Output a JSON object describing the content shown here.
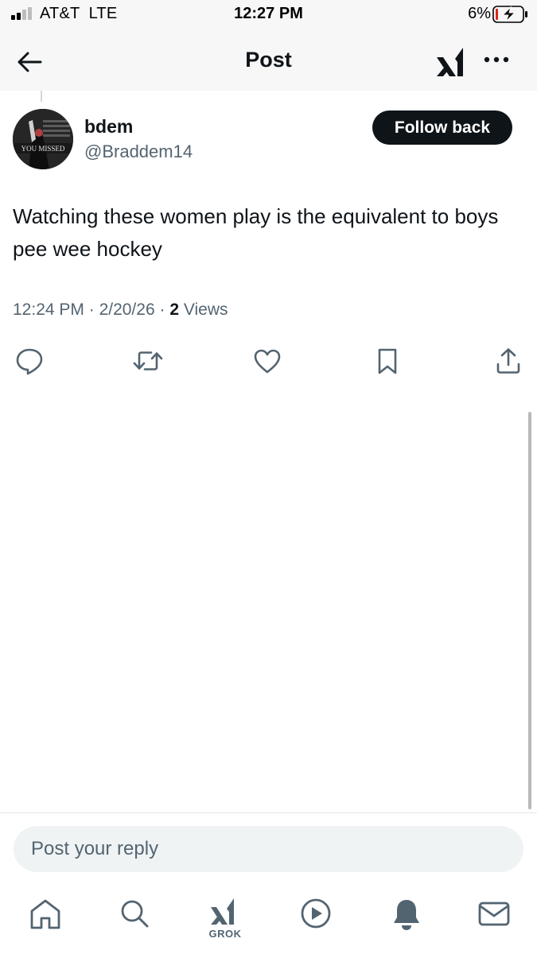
{
  "status_bar": {
    "carrier": "AT&T  LTE",
    "time": "12:27 PM",
    "battery_percent": "6%",
    "icons": [
      "signal-icon",
      "battery-charging-icon"
    ]
  },
  "nav": {
    "title": "Post",
    "icons": [
      "back-arrow-icon",
      "xai-logo-icon",
      "more-icon"
    ]
  },
  "post": {
    "author": {
      "name": "bdem",
      "handle": "@Braddem14",
      "avatar_text": "YOU MISSED"
    },
    "follow_label": "Follow back",
    "text": "Watching these women play is the equivalent to boys pee wee hockey",
    "time": "12:24 PM",
    "date": "2/20/26",
    "views_count": "2",
    "views_label": "Views",
    "separator": " · ",
    "actions": [
      "reply-icon",
      "repost-icon",
      "like-icon",
      "bookmark-icon",
      "share-icon"
    ]
  },
  "reply": {
    "placeholder": "Post your reply"
  },
  "tabbar": {
    "grok_label": "GROK",
    "tabs": [
      "home-icon",
      "search-icon",
      "grok-icon",
      "video-icon",
      "notifications-icon",
      "messages-icon"
    ]
  },
  "colors": {
    "text_primary": "#0f1419",
    "text_secondary": "#536471",
    "button_dark": "#0f1419",
    "reply_bg": "#eff3f4"
  }
}
